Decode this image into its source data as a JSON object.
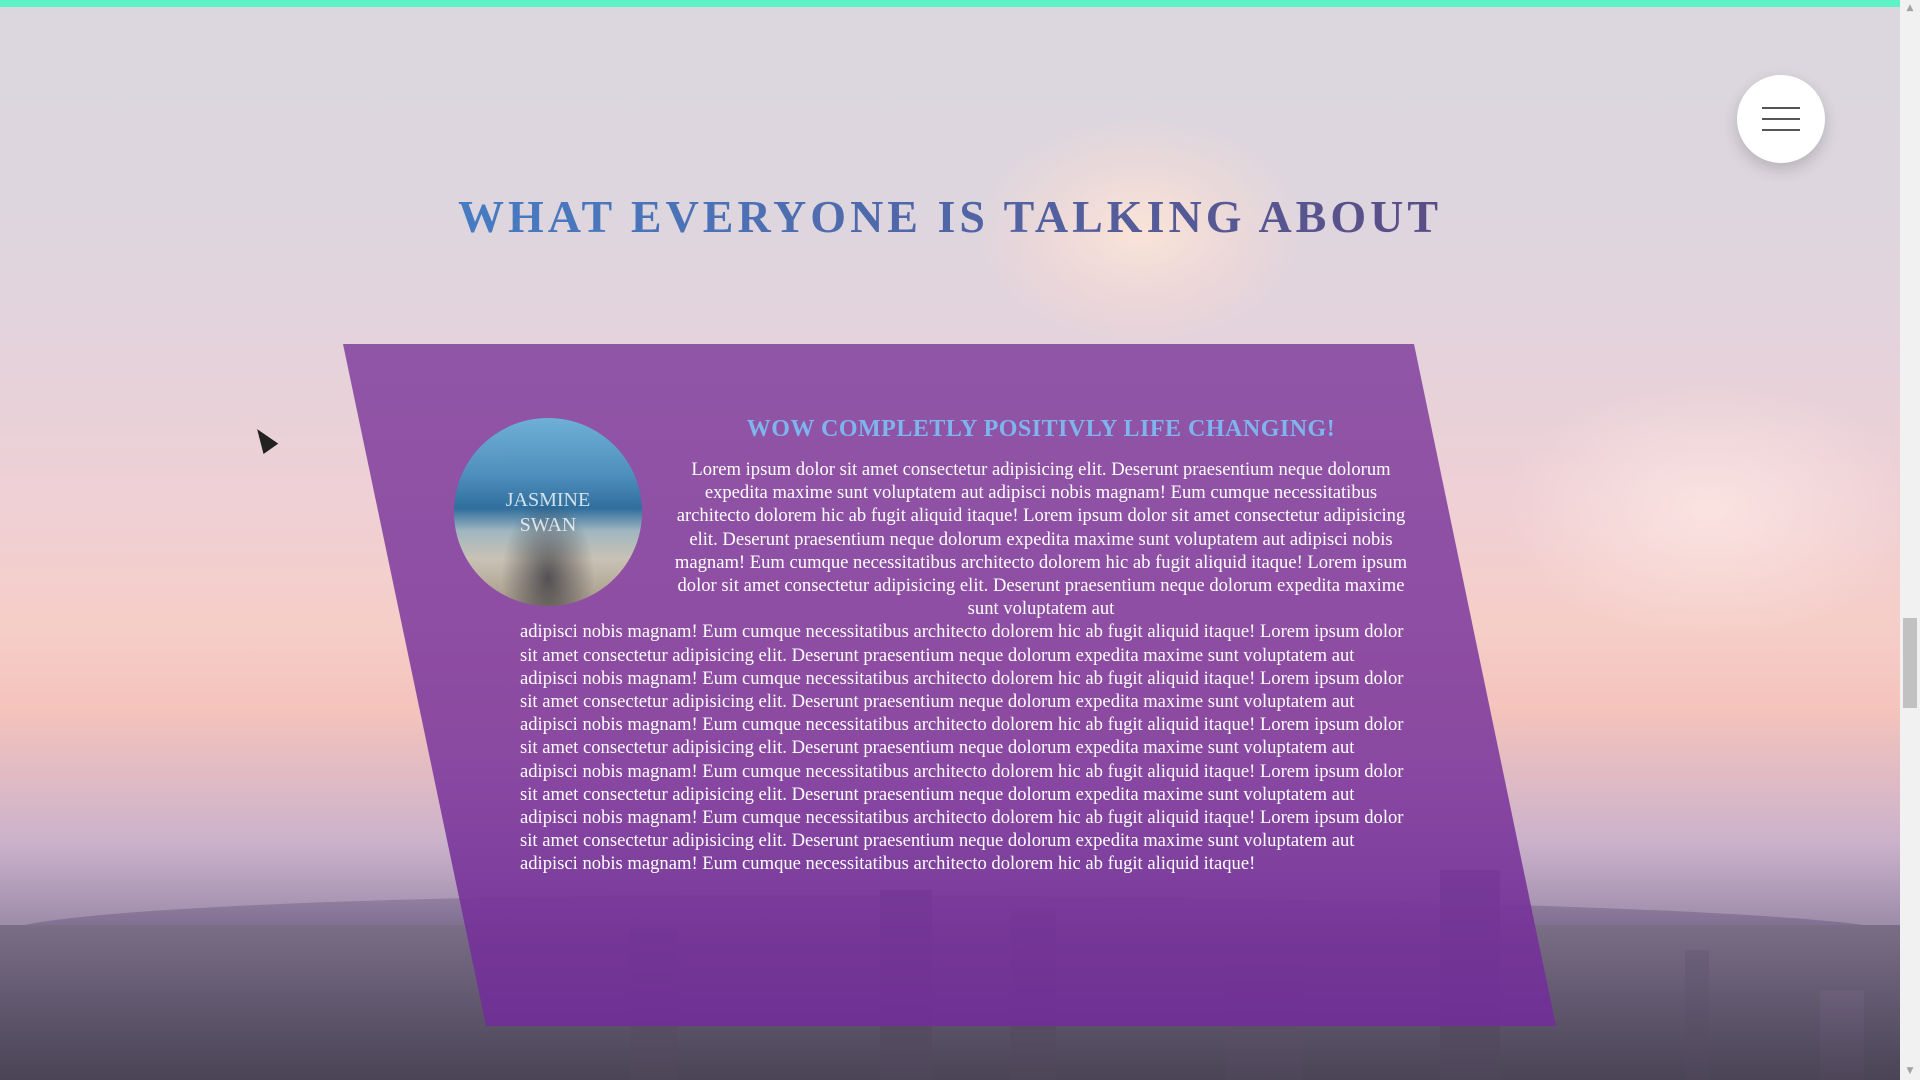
{
  "page": {
    "accent_bar_color": "#5ff2c6",
    "heading": "WHAT EVERYONE IS TALKING ABOUT"
  },
  "menu": {
    "icon": "hamburger-menu-icon"
  },
  "testimonial": {
    "avatar_name": "JASMINE SWAN",
    "title": "WOW COMPLETLY POSITIVLY LIFE CHANGING!",
    "text_wrapped": "Lorem ipsum dolor sit amet consectetur adipisicing elit. Deserunt praesentium neque dolorum expedita maxime sunt voluptatem aut adipisci nobis magnam! Eum cumque necessitatibus architecto dolorem hic ab fugit aliquid itaque! Lorem ipsum dolor sit amet consectetur adipisicing elit. Deserunt praesentium neque dolorum expedita maxime sunt voluptatem aut adipisci nobis magnam! Eum cumque necessitatibus architecto dolorem hic ab fugit aliquid itaque! Lorem ipsum dolor sit amet consectetur adipisicing elit. Deserunt praesentium neque dolorum expedita maxime sunt voluptatem aut",
    "text_body": "adipisci nobis magnam! Eum cumque necessitatibus architecto dolorem hic ab fugit aliquid itaque! Lorem ipsum dolor sit amet consectetur adipisicing elit. Deserunt praesentium neque dolorum expedita maxime sunt voluptatem aut adipisci nobis magnam! Eum cumque necessitatibus architecto dolorem hic ab fugit aliquid itaque! Lorem ipsum dolor sit amet consectetur adipisicing elit. Deserunt praesentium neque dolorum expedita maxime sunt voluptatem aut adipisci nobis magnam! Eum cumque necessitatibus architecto dolorem hic ab fugit aliquid itaque! Lorem ipsum dolor sit amet consectetur adipisicing elit. Deserunt praesentium neque dolorum expedita maxime sunt voluptatem aut adipisci nobis magnam! Eum cumque necessitatibus architecto dolorem hic ab fugit aliquid itaque! Lorem ipsum dolor sit amet consectetur adipisicing elit. Deserunt praesentium neque dolorum expedita maxime sunt voluptatem aut adipisci nobis magnam! Eum cumque necessitatibus architecto dolorem hic ab fugit aliquid itaque! Lorem ipsum dolor sit amet consectetur adipisicing elit. Deserunt praesentium neque dolorum expedita maxime sunt voluptatem aut adipisci nobis magnam! Eum cumque necessitatibus architecto dolorem hic ab fugit aliquid itaque!"
  },
  "colors": {
    "card": "#8a4aa3",
    "title": "#7fb4ee",
    "heading_start": "#3d8fd8",
    "heading_end": "#4b3f6a"
  },
  "scrollbar": {
    "up_icon": "scroll-up-arrow-icon",
    "down_icon": "scroll-down-arrow-icon"
  }
}
